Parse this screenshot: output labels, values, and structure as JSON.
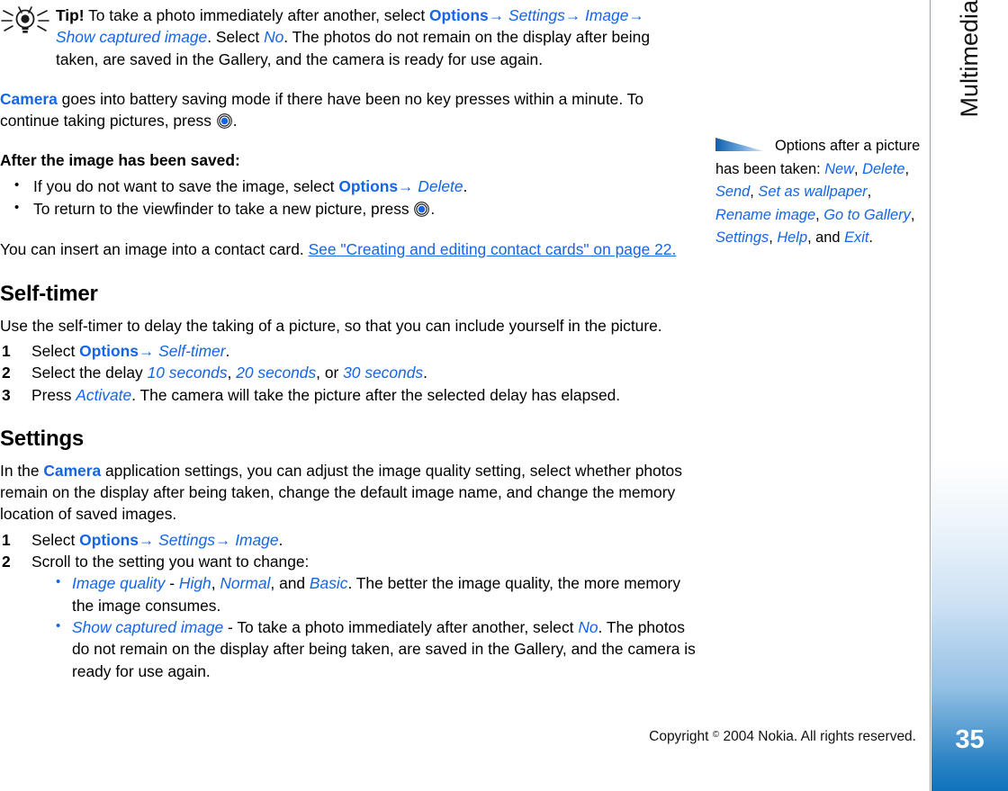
{
  "chapter_tab": {
    "label": "Multimedia"
  },
  "page_number": "35",
  "colors": {
    "accent": "#1565e8",
    "page_tab_blue": "#0f72bb",
    "text": "#000000"
  },
  "tip": {
    "icon": "lightbulb-icon",
    "lead": "Tip!",
    "t1": " To take a photo immediately after another, select ",
    "options": "Options",
    "arrow1": "→",
    "settings": "Settings",
    "arrow2": "→",
    "image": "Image",
    "arrow3": "→",
    "show_captured": "Show captured image",
    "t2": ". Select ",
    "no": "No",
    "t3": ". The photos do not remain on the display after being taken, are saved in the Gallery, and the camera is ready for use again."
  },
  "battery_para": {
    "camera": "Camera",
    "t1": " goes into battery saving mode if there have been no key presses within a minute. To continue taking pictures, press ",
    "navkey_icon": "navigation-key-icon",
    "t2": "."
  },
  "after_saved": {
    "heading": "After the image has been saved:",
    "items": [
      {
        "t1": "If you do not want to save the image, select ",
        "accent": "Options",
        "arrow": "→",
        "italic": "Delete",
        "t2": "."
      },
      {
        "t1": "To return to the viewfinder to take a new picture, press ",
        "navkey_icon": "navigation-key-icon",
        "t2": "."
      }
    ]
  },
  "contact_card_para": {
    "t1": "You can insert an image into a contact card. ",
    "link": "See \"Creating and editing contact cards\" on page 22."
  },
  "self_timer": {
    "heading": "Self-timer",
    "intro": "Use the self-timer to delay the taking of a picture, so that you can include yourself in the picture.",
    "steps": [
      {
        "t1": "Select ",
        "accent": "Options",
        "arrow": "→",
        "italic": "Self-timer",
        "t2": "."
      },
      {
        "t1": "Select the delay ",
        "opt1": "10 seconds",
        "sep1": ", ",
        "opt2": "20 seconds",
        "sep2": ", or ",
        "opt3": "30 seconds",
        "t2": "."
      },
      {
        "t1": "Press ",
        "italic": "Activate",
        "t2": ". The camera will take the picture after the selected delay has elapsed."
      }
    ]
  },
  "settings": {
    "heading": "Settings",
    "intro_t1": "In the ",
    "intro_accent": "Camera",
    "intro_t2": " application settings, you can adjust the image quality setting, select whether photos remain on the display after being taken, change the default image name, and change the memory location of saved images.",
    "step1": {
      "t1": "Select ",
      "accent": "Options",
      "arrow1": "→",
      "italic1": "Settings",
      "arrow2": "→",
      "italic2": "Image",
      "t2": "."
    },
    "step2_label": "Scroll to the setting you want to change:",
    "sub_items": [
      {
        "term": "Image quality",
        "dash": " - ",
        "v1": "High",
        "s1": ", ",
        "v2": "Normal",
        "s2": ", and ",
        "v3": "Basic",
        "rest": ". The better the image quality, the more memory the image consumes."
      },
      {
        "term": "Show captured image",
        "dash": " - ",
        "r1": "To take a photo immediately after another, select ",
        "v1": "No",
        "rest": ". The photos do not remain on the display after being taken, are saved in the Gallery, and the camera is ready for use again."
      }
    ]
  },
  "margin_note": {
    "wedge_icon": "wedge-marker-icon",
    "t1": "Options after a picture has been taken: ",
    "options": [
      "New",
      "Delete",
      "Send",
      "Set as wallpaper",
      "Rename image",
      "Go to Gallery",
      "Settings",
      "Help",
      "Exit"
    ]
  },
  "footer": {
    "prefix": "Copyright ",
    "symbol": "©",
    "text": " 2004 Nokia. All rights reserved."
  }
}
